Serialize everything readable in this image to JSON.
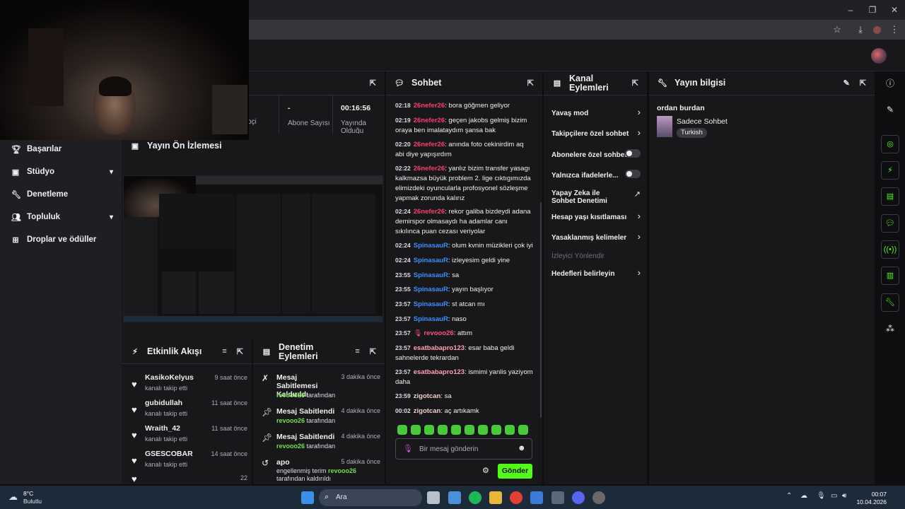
{
  "browser": {
    "window_controls": [
      "–",
      "❐",
      "✕"
    ]
  },
  "sidebar": {
    "items": [
      {
        "label": "Başarılar",
        "icon": "trophy-icon"
      },
      {
        "label": "Stüdyo",
        "icon": "studio-icon"
      },
      {
        "label": "Denetleme",
        "icon": "wrench-icon"
      },
      {
        "label": "Topluluk",
        "icon": "community-icon"
      },
      {
        "label": "Droplar ve ödüller",
        "icon": "drops-icon"
      }
    ]
  },
  "stats": {
    "col1_sub": "oçi",
    "col2_value": "-",
    "col2_sub": "Abone Sayısı",
    "col3_value": "00:16:56",
    "col3_sub": "Yayında Olduğu"
  },
  "preview": {
    "title": "Yayın Ön İzlemesi"
  },
  "activity": {
    "title": "Etkinlik Akışı",
    "items": [
      {
        "name": "KasikoKelyus",
        "time": "9 saat önce",
        "desc": "kanalı takip etti"
      },
      {
        "name": "gubidullah",
        "time": "11 saat önce",
        "desc": "kanalı takip etti"
      },
      {
        "name": "Wraith_42",
        "time": "11 saat önce",
        "desc": "kanalı takip etti"
      },
      {
        "name": "GSESCOBAR",
        "time": "14 saat önce",
        "desc": "kanalı takip etti"
      },
      {
        "name": "",
        "time": "22",
        "desc": ""
      }
    ]
  },
  "modactions": {
    "title": "Denetim Eylemleri",
    "items": [
      {
        "title": "Mesaj Sabitlemesi Kaldırıldı",
        "time": "3 dakika önce",
        "by_user": "revooo26",
        "by_text": "tarafından"
      },
      {
        "title": "Mesaj Sabitlendi",
        "time": "4 dakika önce",
        "by_user": "revooo26",
        "by_text": "tarafından"
      },
      {
        "title": "Mesaj Sabitlendi",
        "time": "4 dakika önce",
        "by_user": "revooo26",
        "by_text": "tarafından"
      },
      {
        "title": "apo",
        "time": "5 dakika önce",
        "by_user": "revooo26",
        "by_text": "engellenmiş terim",
        "extra": "tarafından kaldırıldı"
      }
    ]
  },
  "chat": {
    "title": "Sohbet",
    "messages": [
      {
        "t": "02:18",
        "u": "26nefer26",
        "m": "bora göğmen geliyor"
      },
      {
        "t": "02:19",
        "u": "26nefer26",
        "m": "geçen jakobs gelmiş bizim oraya ben imalataydım şansa bak"
      },
      {
        "t": "02:20",
        "u": "26nefer26",
        "m": "anında foto cekinirdim aq abi diye yapışırdım"
      },
      {
        "t": "02:22",
        "u": "26nefer26",
        "m": "yanlız bizim transfer yasagı kalkmazsa büyük problem 2. lige cıktıgımızda elimizdeki oyuncularla profosyonel sözleşme yapmak zorunda kalırız"
      },
      {
        "t": "02:24",
        "u": "26nefer26",
        "m": "rekor galiba bizdeydi adana demirspor olmasaydı ha adamlar canı sıkılınca puan cezası veriyolar"
      },
      {
        "t": "02:24",
        "u": "SpinasauR",
        "m": "olum kvnin müzikleri çok iyi"
      },
      {
        "t": "02:24",
        "u": "SpinasauR",
        "m": "izleyesim geldi yine"
      },
      {
        "t": "23:55",
        "u": "SpinasauR",
        "m": "sa"
      },
      {
        "t": "23:55",
        "u": "SpinasauR",
        "m": "yayın başlıyor"
      },
      {
        "t": "23:57",
        "u": "SpinasauR",
        "m": "st atcan mı"
      },
      {
        "t": "23:57",
        "u": "SpinasauR",
        "m": "naso"
      },
      {
        "t": "23:57",
        "u": "revooo26",
        "m": "attım"
      },
      {
        "t": "23:57",
        "u": "esatbabapro123",
        "m": "esar baba geldi sahnelerde tekrardan"
      },
      {
        "t": "23:57",
        "u": "esatbabapro123",
        "m": "ismimi yanlis yaziyom daha"
      },
      {
        "t": "23:59",
        "u": "zigotcan",
        "m": "sa"
      },
      {
        "t": "00:02",
        "u": "zigotcan",
        "m": "aç artıkamk"
      }
    ],
    "input_placeholder": "Bir mesaj gönderin",
    "send_label": "Gönder"
  },
  "channel_actions": {
    "title": "Kanal Eylemleri",
    "items": [
      {
        "label": "Yavaş mod",
        "kind": "arrow"
      },
      {
        "label": "Takipçilere özel sohbet",
        "kind": "arrow"
      },
      {
        "label": "Abonelere özel sohbet",
        "kind": "toggle"
      },
      {
        "label": "Yalnızca ifadelerle...",
        "kind": "toggle"
      },
      {
        "label": "Yapay Zeka ile Sohbet Denetimi",
        "kind": "external"
      },
      {
        "label": "Hesap yaşı kısıtlaması",
        "kind": "arrow"
      },
      {
        "label": "Yasaklanmış kelimeler",
        "kind": "arrow"
      },
      {
        "label": "İzleyici Yönlendir",
        "kind": "disabled"
      },
      {
        "label": "Hedefleri belirleyin",
        "kind": "arrow"
      }
    ]
  },
  "stream_info": {
    "title": "Yayın bilgisi",
    "stream_title": "ordan burdan",
    "category": "Sadece Sohbet",
    "tag": "Turkish"
  },
  "taskbar": {
    "weather_temp": "8°C",
    "weather_desc": "Bulutlu",
    "search_label": "Ara",
    "time": "00:07",
    "date": "10.04.2026"
  }
}
